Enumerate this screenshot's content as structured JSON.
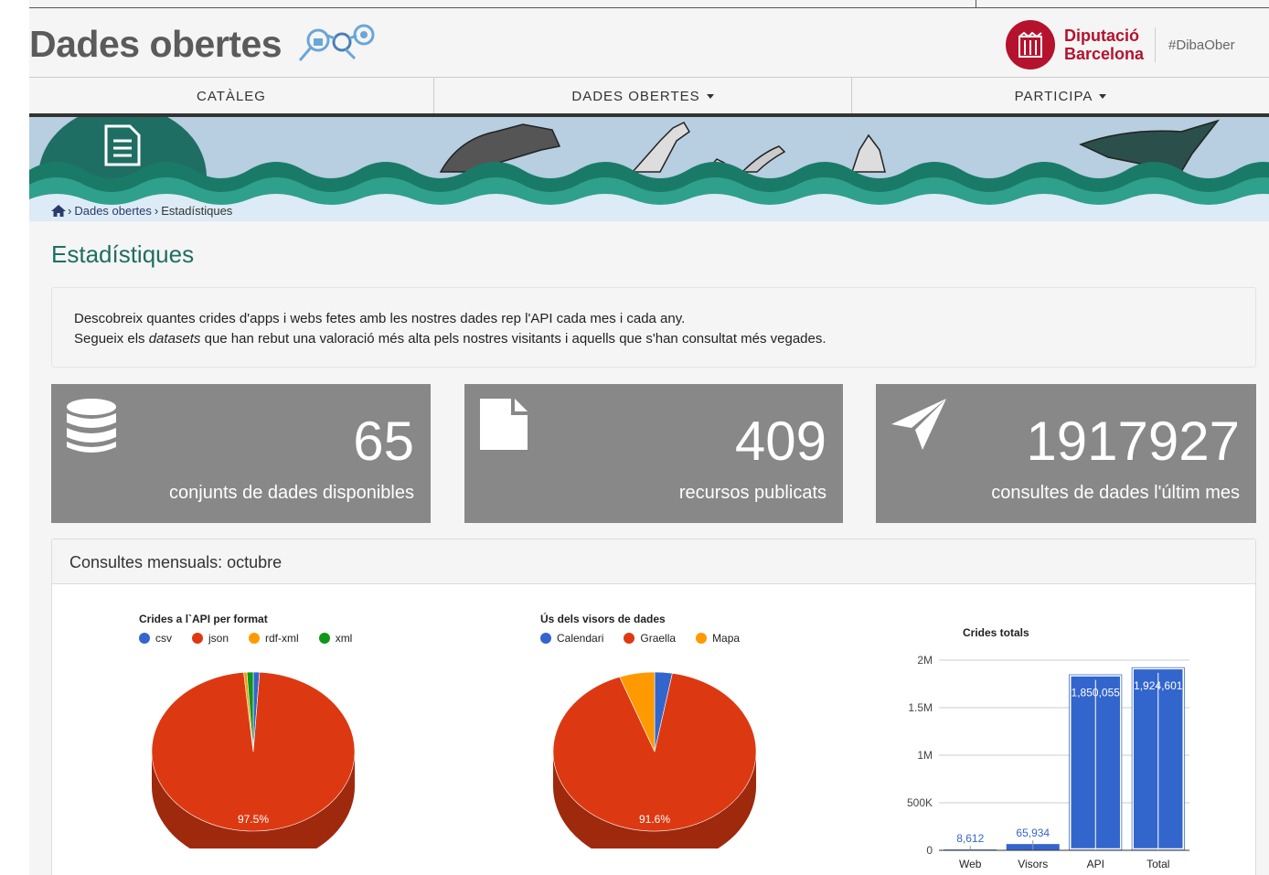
{
  "brand": {
    "title": "Dades obertes"
  },
  "partner": {
    "name_line1": "Diputació",
    "name_line2": "Barcelona",
    "hashtag": "#DibaOber"
  },
  "nav": {
    "items": [
      {
        "label": "CATÀLEG"
      },
      {
        "label": "DADES OBERTES"
      },
      {
        "label": "PARTICIPA"
      }
    ]
  },
  "breadcrumb": {
    "items": [
      "Dades obertes",
      "Estadístiques"
    ],
    "separator": "›"
  },
  "page": {
    "title": "Estadístiques"
  },
  "intro": {
    "line1": "Descobreix quantes crides d'apps i webs fetes amb les nostres dades rep l'API cada mes i cada any.",
    "line2_pre": "Segueix els ",
    "line2_em": "datasets",
    "line2_post": " que han rebut una valoració més alta pels nostres visitants i aquells que s'han consultat més vegades."
  },
  "stats": [
    {
      "icon": "database-icon",
      "value": "65",
      "label": "conjunts de dades disponibles"
    },
    {
      "icon": "file-icon",
      "value": "409",
      "label": "recursos publicats"
    },
    {
      "icon": "paper-plane-icon",
      "value": "1917927",
      "label": "consultes de dades l'últim mes"
    }
  ],
  "panel": {
    "title": "Consultes mensuals: octubre"
  },
  "colors": {
    "blue": "#3366cc",
    "red": "#dc3912",
    "orange": "#ff9900",
    "green": "#109618",
    "teal": "#1f6e63"
  },
  "chart_data": [
    {
      "type": "pie",
      "title": "Crides a l`API per format",
      "categories": [
        "csv",
        "json",
        "rdf-xml",
        "xml"
      ],
      "values": [
        1.0,
        97.5,
        0.5,
        1.0
      ],
      "slice_label": "97.5%",
      "legend": "top"
    },
    {
      "type": "pie",
      "title": "Ús dels visors de dades",
      "categories": [
        "Calendari",
        "Graella",
        "Mapa"
      ],
      "values": [
        2.8,
        91.6,
        5.6
      ],
      "slice_label": "91.6%",
      "legend": "top"
    },
    {
      "type": "bar",
      "title": "Crides totals",
      "categories": [
        "Web",
        "Visors",
        "API",
        "Total"
      ],
      "values": [
        8612,
        65934,
        1850055,
        1924601
      ],
      "data_labels": [
        "8,612",
        "65,934",
        "1,850,055",
        "1,924,601"
      ],
      "yticks": [
        "0",
        "500K",
        "1M",
        "1.5M",
        "2M"
      ],
      "ylim": [
        0,
        2000000
      ]
    }
  ]
}
